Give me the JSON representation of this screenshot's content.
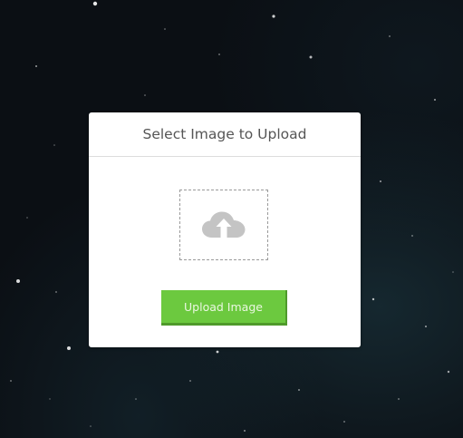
{
  "dialog": {
    "title": "Select Image to Upload",
    "dropzone_icon": "cloud-upload-icon",
    "upload_button_label": "Upload Image"
  },
  "colors": {
    "background": "#0b0f14",
    "card": "#ffffff",
    "button": "#6cc93f",
    "button_shadow": "#4f9a2b",
    "icon": "#c4c4c4",
    "title_text": "#555555"
  }
}
